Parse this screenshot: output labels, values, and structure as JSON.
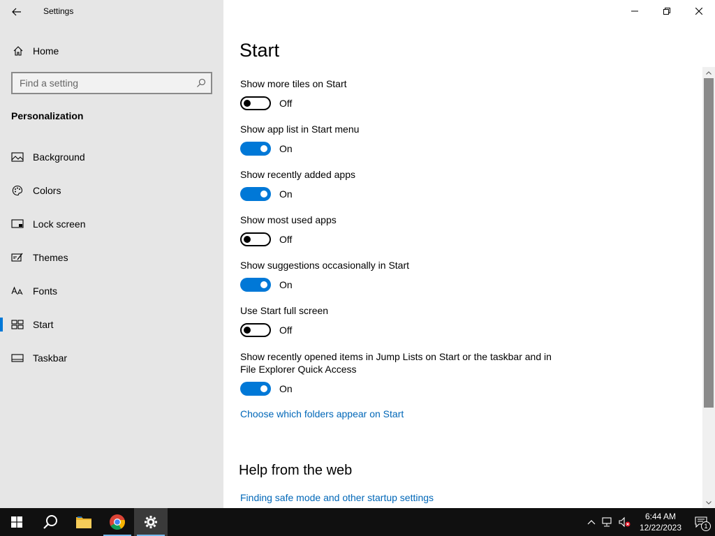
{
  "window": {
    "title": "Settings"
  },
  "sidebar": {
    "home_label": "Home",
    "search_placeholder": "Find a setting",
    "section_title": "Personalization",
    "items": [
      {
        "label": "Background",
        "icon": "picture-icon"
      },
      {
        "label": "Colors",
        "icon": "palette-icon"
      },
      {
        "label": "Lock screen",
        "icon": "lock-screen-icon"
      },
      {
        "label": "Themes",
        "icon": "themes-icon"
      },
      {
        "label": "Fonts",
        "icon": "fonts-icon"
      },
      {
        "label": "Start",
        "icon": "start-icon",
        "active": true
      },
      {
        "label": "Taskbar",
        "icon": "taskbar-icon"
      }
    ]
  },
  "main": {
    "title": "Start",
    "settings": [
      {
        "label": "Show more tiles on Start",
        "state": "Off"
      },
      {
        "label": "Show app list in Start menu",
        "state": "On"
      },
      {
        "label": "Show recently added apps",
        "state": "On"
      },
      {
        "label": "Show most used apps",
        "state": "Off"
      },
      {
        "label": "Show suggestions occasionally in Start",
        "state": "On"
      },
      {
        "label": "Use Start full screen",
        "state": "Off"
      },
      {
        "label_line1": "Show recently opened items in Jump Lists on Start or the taskbar and in",
        "label_line2": "File Explorer Quick Access",
        "state": "On"
      }
    ],
    "folders_link": "Choose which folders appear on Start",
    "help_title": "Help from the web",
    "help_link": "Finding safe mode and other startup settings"
  },
  "taskbar": {
    "apps": [
      "start-icon",
      "search-icon",
      "file-explorer-icon",
      "chrome-icon",
      "settings-icon"
    ],
    "time": "6:44 AM",
    "date": "12/22/2023",
    "notification_count": "1"
  },
  "colors": {
    "accent": "#0078d7",
    "link": "#0067b8",
    "sidebar_bg": "#e6e6e6"
  }
}
